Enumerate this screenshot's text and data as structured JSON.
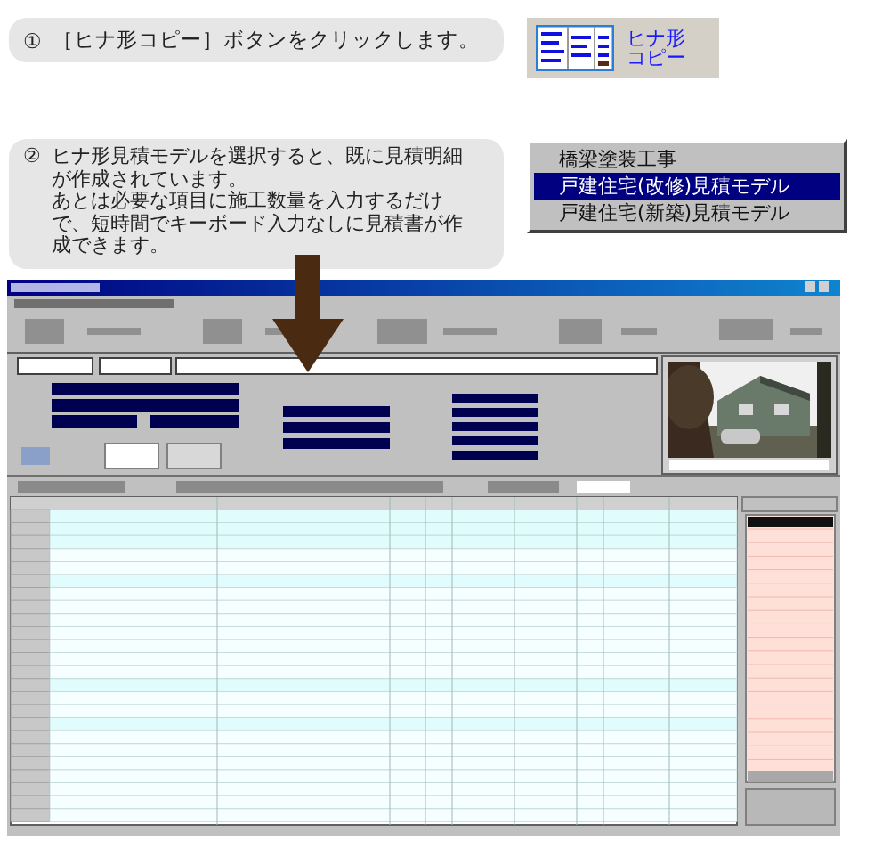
{
  "steps": [
    {
      "number": "①",
      "text": "［ヒナ形コピー］ボタンをクリックします。"
    },
    {
      "number": "②",
      "paragraphs": [
        "ヒナ形見積モデルを選択すると、既に見積明細が作成されています。",
        "あとは必要な項目に施工数量を入力するだけで、短時間でキーボード入力なしに見積書が作成できます。"
      ]
    }
  ],
  "copy_button": {
    "label_lines": [
      "ヒナ形",
      "コピー"
    ]
  },
  "model_list": [
    {
      "label": "橋梁塗装工事",
      "selected": false
    },
    {
      "label": "戸建住宅(改修)見積モデル",
      "selected": true
    },
    {
      "label": "戸建住宅(新築)見積モデル",
      "selected": false
    }
  ]
}
